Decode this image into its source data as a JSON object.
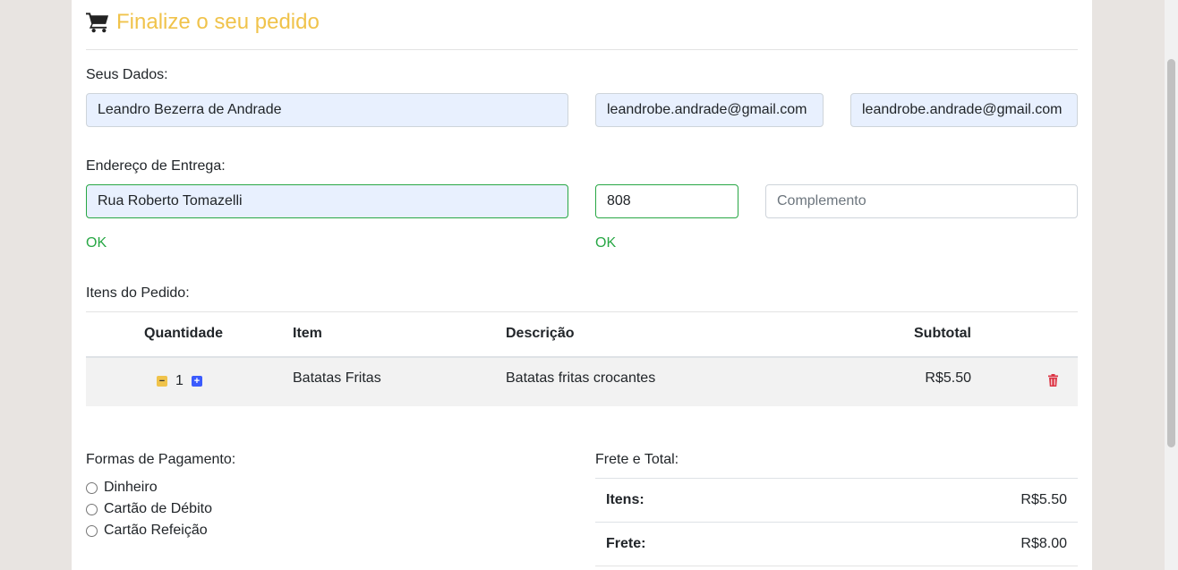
{
  "header": {
    "title": "Finalize o seu pedido",
    "cart_icon": "cart-icon"
  },
  "customer": {
    "section_label": "Seus Dados:",
    "name": "Leandro Bezerra de Andrade",
    "email": "leandrobe.andrade@gmail.com",
    "email_confirm": "leandrobe.andrade@gmail.com"
  },
  "address": {
    "section_label": "Endereço de Entrega:",
    "street": "Rua Roberto Tomazelli",
    "number": "808",
    "complement_placeholder": "Complemento",
    "street_status": "OK",
    "number_status": "OK"
  },
  "order": {
    "section_label": "Itens do Pedido:",
    "columns": {
      "quantity": "Quantidade",
      "item": "Item",
      "description": "Descrição",
      "subtotal": "Subtotal"
    },
    "items": [
      {
        "quantity": "1",
        "item": "Batatas Fritas",
        "description": "Batatas fritas crocantes",
        "subtotal": "R$5.50"
      }
    ]
  },
  "payment": {
    "section_label": "Formas de Pagamento:",
    "options": [
      "Dinheiro",
      "Cartão de Débito",
      "Cartão Refeição"
    ]
  },
  "totals": {
    "section_label": "Frete e Total:",
    "items_label": "Itens:",
    "items_value": "R$5.50",
    "shipping_label": "Frete:",
    "shipping_value": "R$8.00"
  },
  "colors": {
    "accent": "#f0c34b",
    "valid": "#28a745",
    "minus": "#f0c34b",
    "plus": "#3b5bfd",
    "delete": "#dc3545"
  }
}
